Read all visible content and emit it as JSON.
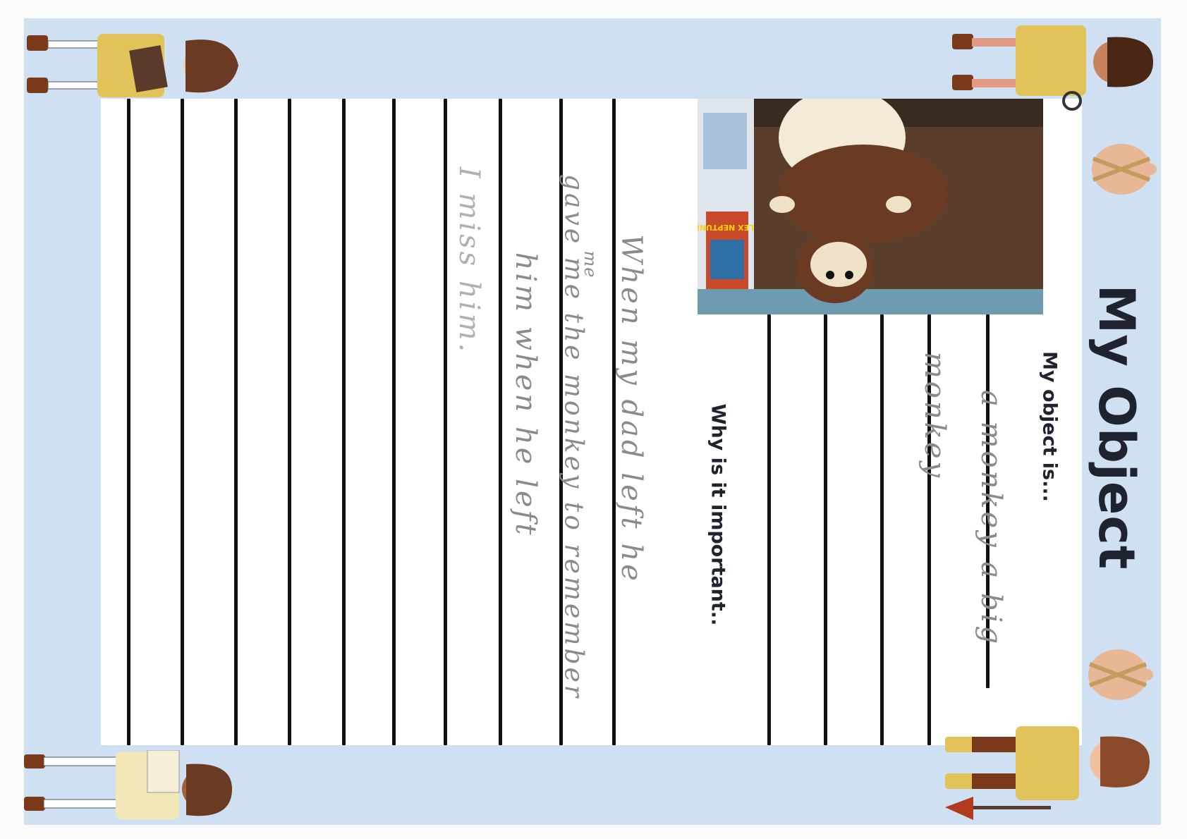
{
  "page": {
    "title": "My Object",
    "object_heading": "My object is...",
    "why_heading": "Why is it important..",
    "object_answer": [
      "a monkey a big",
      "monkey"
    ],
    "why_answer": [
      "When my dad left he",
      "gave me the monkey to remember",
      "him when he left",
      "I miss him."
    ],
    "answer_insert": "me",
    "photo_book_title": "ALEX NEPTUNE"
  },
  "colors": {
    "frame": "#cfe0f3",
    "ink": "#1f2330",
    "pencil": "#8a8a8a"
  },
  "icons": [
    "explorer-reading-book-icon",
    "explorer-with-magnifier-icon",
    "explorer-reading-map-icon",
    "explorer-with-spade-icon",
    "tied-sack-icon"
  ]
}
